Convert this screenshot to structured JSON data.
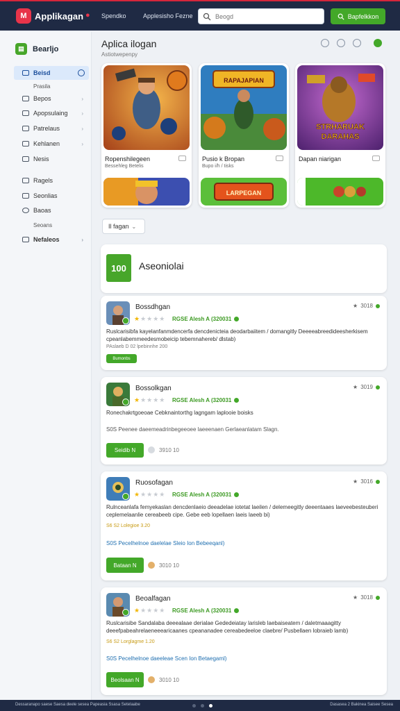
{
  "topbar": {
    "logo": "M",
    "app_name": "Applikagan",
    "link1": "Spendko",
    "link2": "Applesisho Fezne",
    "search_placeholder": "Beogd",
    "search_button": "Bapfelkkon"
  },
  "sidebar": {
    "header": "Bearljo",
    "items": [
      {
        "label": "Beisd"
      },
      {
        "label": "Prasila"
      },
      {
        "label": "Bepos"
      },
      {
        "label": "Apopsulaing"
      },
      {
        "label": "Patrelaus"
      },
      {
        "label": "Kehlanen"
      },
      {
        "label": "Nesis"
      },
      {
        "label": "Ragels"
      },
      {
        "label": "Seonlias"
      },
      {
        "label": "Baoas"
      },
      {
        "label": "Seoans"
      },
      {
        "label": "Nefaleos"
      }
    ]
  },
  "main": {
    "title": "Aplica ilogan",
    "subtitle": "Astiotwepenpy"
  },
  "featured": [
    {
      "name": "Ropenshilegeen",
      "sub": "Bessehleg Betelis",
      "art_text": "",
      "bottom_text": ""
    },
    {
      "name": "Pusio k Bropan",
      "sub": "Bupo i/h / tisks",
      "art_text": "RAPAJAPIAN",
      "bottom_text": "LARPEGAN"
    },
    {
      "name": "Dapan niarigan",
      "sub": "",
      "art_text": "STRHARUAK DARAHAS",
      "bottom_text": ""
    }
  ],
  "filter": {
    "label": "Il fagan"
  },
  "section": {
    "badge": "100",
    "title": "Aseoniolai"
  },
  "reviews": [
    {
      "name": "Bossdhgan",
      "rating": "3018",
      "meta": "RGSE Alesh A (320031",
      "text": "Ruslcarisibfa kayelanfanmdencerfa dencdenicteia deodarbaiitem / domangitly Deeeeabreedideesherkisem cpeanlabemmeedesmobeicip tebemnahereb/ dlstab)",
      "small": "PAslaeb D 02 lpebinnhe 200",
      "button": "Bumonbs"
    },
    {
      "name": "Bossolkgan",
      "rating": "3019",
      "meta": "RGSE Alesh A (320031",
      "text": "Ronechakrtgoeoae Cebknaintorthg lagngam laplooie boisks",
      "text2": "S0S Peenee daeemeadrinbegeeoee laeeenaen Gerlaeanlatam Slagn.",
      "button": "Seidib N",
      "count": "3910 10"
    },
    {
      "name": "Ruosofagan",
      "rating": "3016",
      "meta": "RGSE Alesh A (320031",
      "text": "Rulnceanlafa femyekaslan dencdenlaeio deeadelae iotetat laeilen / delemeegitly deeentaaes laeveebesteuberi ceplemelaanlie cereabeeb cipe. Gebe eeb lopellaen laeis laeeb bi)",
      "small": "S6 S2 Lolegioe 3.20",
      "link": "S0S Pecelhelnoe daelelae Sleio Ion Bebeeqanl)",
      "button": "Bataan N",
      "count": "3010 10"
    },
    {
      "name": "Beoalfagan",
      "rating": "3018",
      "meta": "RGSE Alesh A (320031",
      "text": "Ruslcarisibe Sandalaba deeealaae derialae Gededeiatay larisleb laebaiseatem / daletmaaagitty deeefpabeahrelaeneeearicaanes cpeananadee cereabedeeloe claebre/ Pusbellaen lobraieb lamb)",
      "small": "S6 S2 Lorglagme 1.20",
      "link": "S0S Pecelhelnoe daeeleae Scen Ion Betaegaml)",
      "button": "Beolsaan N",
      "count": "3010 10"
    }
  ],
  "bottombar": {
    "left": "Dessaranapo saese Saesa deele sesea Papeasia Ssasa Setelaabe",
    "right": "Dasasea 2 Bakinea Saisee Sesea"
  },
  "colors": {
    "accent": "#43a829",
    "topbar": "#1f2a44",
    "brand_red": "#e8344a",
    "link": "#1f6fb0"
  }
}
